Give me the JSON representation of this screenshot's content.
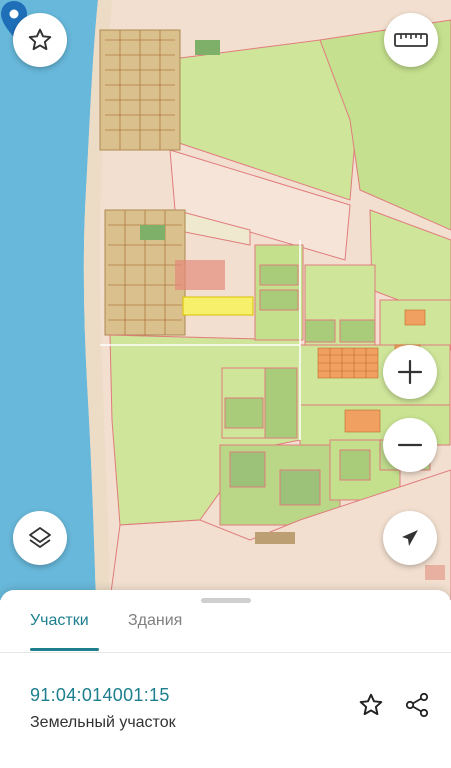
{
  "map": {
    "icons": {
      "favorite": "star-outline-icon",
      "ruler": "ruler-icon",
      "zoom_in": "plus-icon",
      "zoom_out": "minus-icon",
      "layers": "layers-icon",
      "locate": "navigation-arrow-icon",
      "marker": "map-pin-icon"
    },
    "colors": {
      "sea": "#68b8db",
      "fields": "#cfe59a",
      "parcel_outline": "#e07c7c",
      "selected_parcel": "#f7f06a",
      "accent": "#1d7f8d",
      "pin": "#1f6fb8"
    }
  },
  "sheet": {
    "tabs": [
      {
        "label": "Участки",
        "active": true
      },
      {
        "label": "Здания",
        "active": false
      }
    ],
    "parcel": {
      "cadastral_number": "91:04:014001:15",
      "type": "Земельный участок"
    },
    "actions": {
      "favorite_icon": "star-outline-icon",
      "share_icon": "share-icon"
    }
  }
}
